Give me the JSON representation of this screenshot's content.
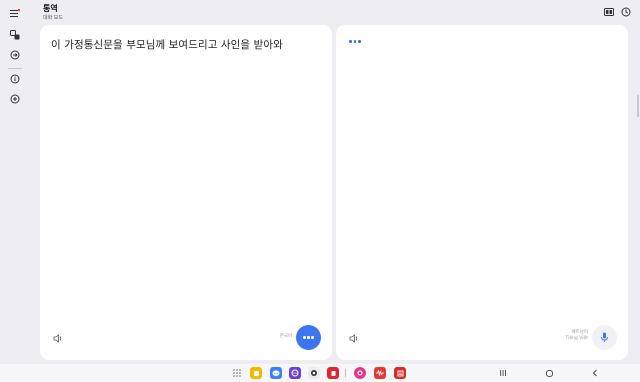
{
  "app": {
    "title": "통역",
    "subtitle": "대화 모드"
  },
  "left_panel": {
    "source_text": "이 가정통신문을 부모님께 보여드리고 사인을 받아와",
    "lang_label": "한국어"
  },
  "right_panel": {
    "lang_label_line1": "베트남어",
    "lang_label_line2": "Tiếng Việt"
  },
  "colors": {
    "accent": "#3d74f0"
  },
  "taskbar": {
    "apps": [
      "app-drawer-icon",
      "notes-icon",
      "messages-icon",
      "internet-icon",
      "camera-icon",
      "store-icon",
      "gallery-icon",
      "voice-recorder-icon",
      "office-icon"
    ]
  }
}
